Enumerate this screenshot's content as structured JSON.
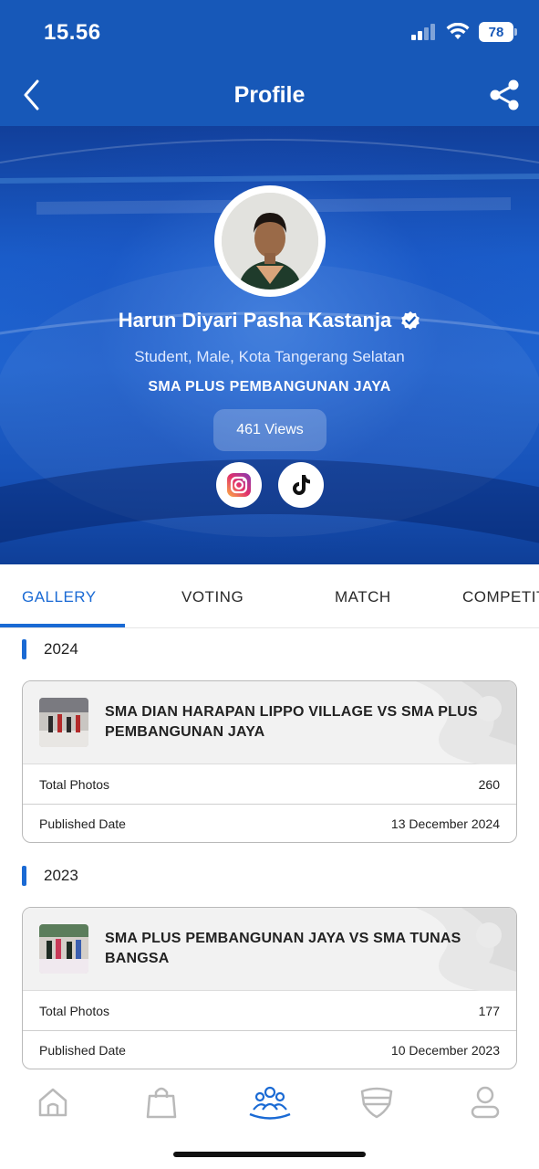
{
  "status_bar": {
    "time": "15.56",
    "battery": "78"
  },
  "app_bar": {
    "title": "Profile",
    "back_icon": "chevron-left-icon",
    "share_icon": "share-icon"
  },
  "profile": {
    "name": "Harun Diyari Pasha Kastanja",
    "verified": true,
    "subtitle": "Student, Male, Kota Tangerang Selatan",
    "school": "SMA PLUS PEMBANGUNAN JAYA",
    "views": "461 Views",
    "social": [
      {
        "name": "instagram",
        "icon": "instagram-icon"
      },
      {
        "name": "tiktok",
        "icon": "tiktok-icon"
      }
    ]
  },
  "tabs": [
    {
      "label": "GALLERY",
      "active": true
    },
    {
      "label": "VOTING",
      "active": false
    },
    {
      "label": "MATCH",
      "active": false
    },
    {
      "label": "COMPETITI",
      "active": false
    }
  ],
  "gallery": [
    {
      "year": "2024",
      "title": "SMA DIAN HARAPAN LIPPO VILLAGE VS SMA PLUS PEMBANGUNAN JAYA",
      "total_photos_label": "Total Photos",
      "total_photos": "260",
      "published_label": "Published Date",
      "published_date": "13 December 2024"
    },
    {
      "year": "2023",
      "title": "SMA PLUS PEMBANGUNAN JAYA VS SMA TUNAS BANGSA",
      "total_photos_label": "Total Photos",
      "total_photos": "177",
      "published_label": "Published Date",
      "published_date": "10 December 2023"
    }
  ],
  "bottom_nav": [
    {
      "icon": "home-icon",
      "active": false
    },
    {
      "icon": "shopping-bag-icon",
      "active": false
    },
    {
      "icon": "community-icon",
      "active": true
    },
    {
      "icon": "shield-icon",
      "active": false
    },
    {
      "icon": "user-icon",
      "active": false
    }
  ],
  "colors": {
    "primary": "#1758b8",
    "accent": "#1a6ad4",
    "text": "#1f1f1f"
  }
}
